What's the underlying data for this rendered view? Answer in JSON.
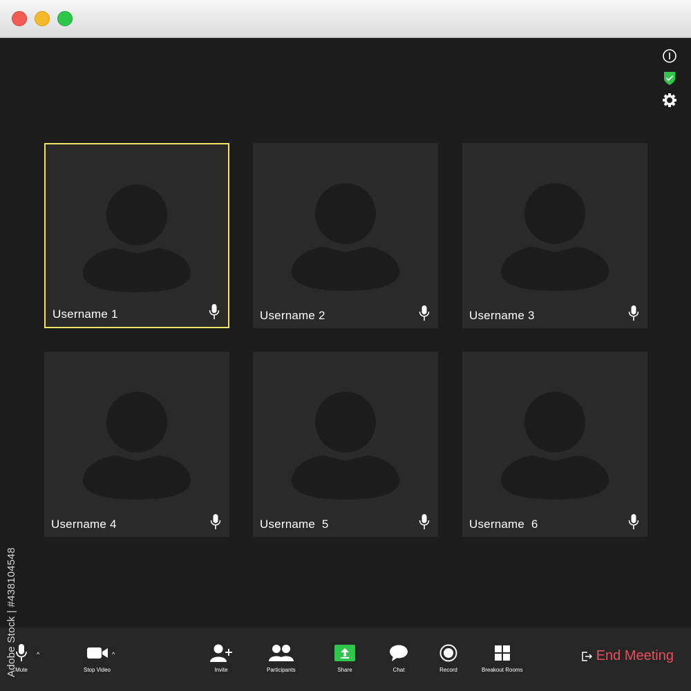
{
  "window": {
    "colors": {
      "close": "#f25c54",
      "minimize": "#f6b92c",
      "zoom": "#2ec64b",
      "background": "#1c1c1c",
      "tile": "#2a2a2a",
      "active_border": "#f3e463"
    }
  },
  "top_icons": [
    "info-icon",
    "security-shield-icon",
    "settings-gear-icon"
  ],
  "participants": [
    {
      "name": "Username 1",
      "active": true
    },
    {
      "name": "Username 2",
      "active": false
    },
    {
      "name": "Username 3",
      "active": false
    },
    {
      "name": "Username 4",
      "active": false
    },
    {
      "name": "Username  5",
      "active": false
    },
    {
      "name": "Username  6",
      "active": false
    }
  ],
  "toolbar": {
    "mute": "Mute",
    "stop_video": "Stop Video",
    "invite": "Invite",
    "participants": "Participants",
    "share": "Share",
    "chat": "Chat",
    "record": "Record",
    "breakout_rooms": "Breakout Rooms",
    "end_meeting": "End Meeting",
    "share_color": "#2ec64b",
    "end_color": "#e8505b"
  },
  "side_text": "Adobe Stock | #438104548"
}
